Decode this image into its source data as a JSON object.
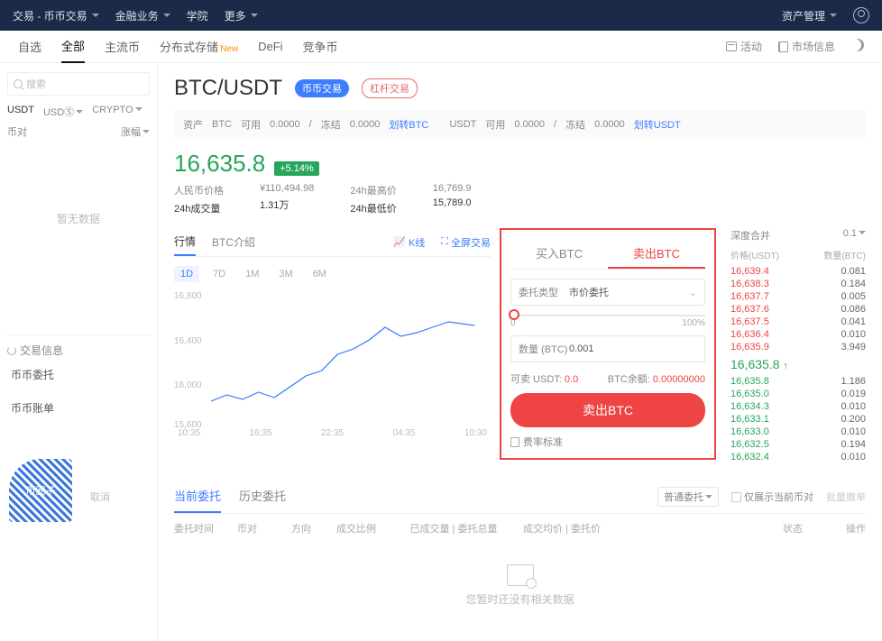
{
  "topnav": {
    "left": [
      "交易 - 币币交易",
      "金融业务",
      "学院",
      "更多"
    ],
    "right": [
      "资产管理"
    ]
  },
  "subnav": {
    "tabs": [
      "自选",
      "全部",
      "主流币",
      "分布式存储",
      "DeFi",
      "竞争币"
    ],
    "new_badge": "New",
    "right": {
      "activity": "活动",
      "market": "市场信息"
    }
  },
  "sidebar": {
    "search_placeholder": "搜索",
    "quote_tabs": [
      "USDT",
      "USDⓈ",
      "CRYPTO"
    ],
    "col_pair": "币对",
    "col_change": "涨幅",
    "empty": "暂无数据",
    "section_title": "交易信息",
    "links": [
      "币币委托",
      "币币账单"
    ]
  },
  "pair": {
    "symbol": "BTC/USDT",
    "pill_spot": "币币交易",
    "pill_margin": "杠杆交易"
  },
  "assets": {
    "label": "资产",
    "btc_label": "BTC",
    "avail_label": "可用",
    "btc_avail": "0.0000",
    "frozen_label": "冻结",
    "btc_frozen": "0.0000",
    "transfer_btc": "划转BTC",
    "usdt_label": "USDT",
    "usdt_avail": "0.0000",
    "usdt_frozen": "0.0000",
    "transfer_usdt": "划转USDT"
  },
  "price": {
    "last": "16,635.8",
    "change_pct": "+5.14%",
    "stats": {
      "cny_label": "人民币价格",
      "cny": "¥110,494.98",
      "vol_label": "24h成交量",
      "vol": "1.31万",
      "high_label": "24h最高价",
      "high": "16,769.9",
      "low_label": "24h最低价",
      "low": "15,789.0"
    }
  },
  "chart": {
    "tabs": [
      "行情",
      "BTC介绍"
    ],
    "kline_btn": "K线",
    "fullscreen_btn": "全屏交易",
    "timeframes": [
      "1D",
      "7D",
      "1M",
      "3M",
      "6M"
    ],
    "y_ticks": [
      "16,800",
      "16,400",
      "16,000",
      "15,600"
    ],
    "x_ticks": [
      "10:35",
      "16:35",
      "22:35",
      "04:35",
      "10:30"
    ]
  },
  "chart_data": {
    "type": "line",
    "title": "",
    "xlabel": "",
    "ylabel": "",
    "ylim": [
      15600,
      16800
    ],
    "x": [
      "10:35",
      "12:00",
      "13:30",
      "15:00",
      "16:35",
      "18:00",
      "19:30",
      "21:00",
      "22:35",
      "00:00",
      "01:30",
      "03:00",
      "04:35",
      "06:00",
      "07:30",
      "09:00",
      "10:30"
    ],
    "series": [
      {
        "name": "BTC/USDT",
        "values": [
          15820,
          15880,
          15840,
          15900,
          15860,
          15950,
          16050,
          16100,
          16250,
          16300,
          16380,
          16500,
          16420,
          16450,
          16500,
          16550,
          16520
        ]
      }
    ]
  },
  "trade": {
    "buy_tab": "买入BTC",
    "sell_tab": "卖出BTC",
    "order_type_label": "委托类型",
    "order_type_value": "市价委托",
    "slider_min": "0",
    "slider_max": "100%",
    "amount_label": "数量 (BTC)",
    "amount_value": "0.001",
    "can_sell_label": "可卖 USDT:",
    "can_sell_value": "0.0",
    "balance_label": "BTC余额:",
    "balance_value": "0.00000000",
    "sell_button": "卖出BTC",
    "fee_label": "费率标准"
  },
  "orderbook": {
    "depth_label": "深度合并",
    "depth_value": "0.1",
    "col_price": "价格(USDT)",
    "col_amount": "数量(BTC)",
    "asks": [
      {
        "p": "16,639.4",
        "a": "0.081"
      },
      {
        "p": "16,638.3",
        "a": "0.184"
      },
      {
        "p": "16,637.7",
        "a": "0.005"
      },
      {
        "p": "16,637.6",
        "a": "0.086"
      },
      {
        "p": "16,637.5",
        "a": "0.041"
      },
      {
        "p": "16,636.4",
        "a": "0.010"
      },
      {
        "p": "16,635.9",
        "a": "3.949"
      }
    ],
    "mid": "16,635.8",
    "mid_arrow": "↑",
    "bids": [
      {
        "p": "16,635.8",
        "a": "1.186"
      },
      {
        "p": "16,635.0",
        "a": "0.019"
      },
      {
        "p": "16,634.3",
        "a": "0.010"
      },
      {
        "p": "16,633.1",
        "a": "0.200"
      },
      {
        "p": "16,633.0",
        "a": "0.010"
      },
      {
        "p": "16,632.5",
        "a": "0.194"
      },
      {
        "p": "16,632.4",
        "a": "0.010"
      }
    ]
  },
  "orders": {
    "tabs": [
      "当前委托",
      "历史委托"
    ],
    "filter": "普通委托",
    "only_pair": "仅展示当前币对",
    "cancel_all": "批量撤单",
    "cols": [
      "委托时间",
      "币对",
      "方向",
      "成交比例",
      "已成交量 | 委托总量",
      "成交均价 | 委托价",
      "状态",
      "操作"
    ],
    "empty": "您暂时还没有相关数据"
  },
  "overlay": {
    "brand": "币圈子",
    "cancel": "取消"
  }
}
